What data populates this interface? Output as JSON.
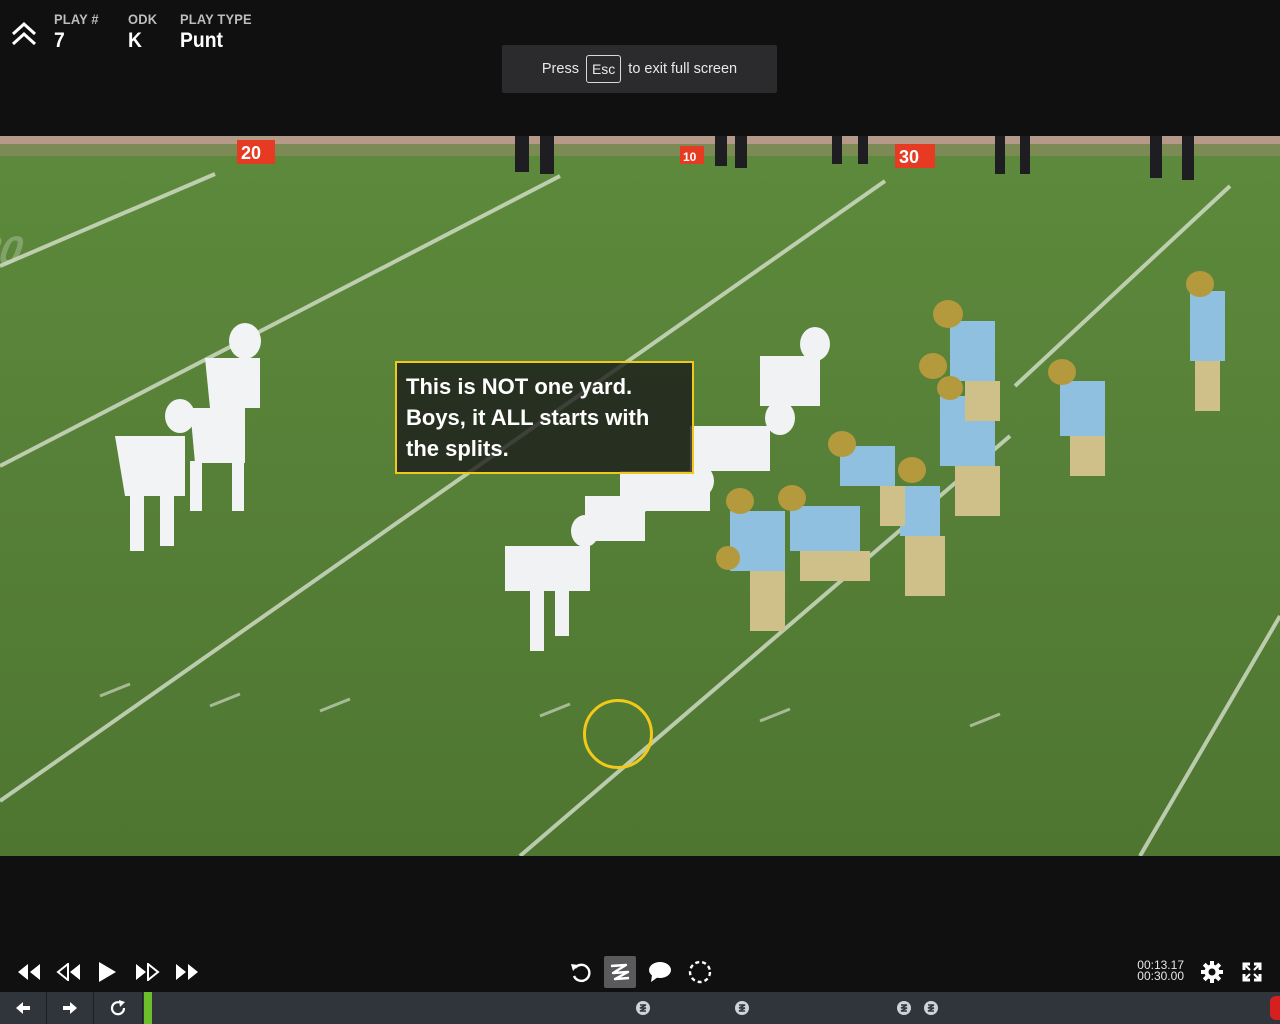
{
  "header": {
    "play_number_label": "PLAY #",
    "play_number_value": "7",
    "odk_label": "ODK",
    "odk_value": "K",
    "play_type_label": "PLAY TYPE",
    "play_type_value": "Punt",
    "collapse_icon": "double-chevron-up-icon"
  },
  "fullscreen_notice": {
    "prefix": "Press",
    "key": "Esc",
    "suffix": "to exit full screen"
  },
  "video": {
    "yard_markers": [
      "20",
      "10",
      "30"
    ],
    "annotation_text": "This is NOT one yard. Boys, it ALL starts with the splits.",
    "annotation_color": "#f2c81a",
    "focus_circle_color": "#f2c81a"
  },
  "controls": {
    "icons": [
      "rewind-icon",
      "step-back-icon",
      "play-icon",
      "step-forward-icon",
      "fast-forward-icon",
      "undo-icon",
      "draw-tool-icon",
      "comment-icon",
      "circle-tool-icon",
      "settings-icon",
      "fullscreen-icon"
    ],
    "current_time": "00:13.17",
    "total_time": "00:30.00"
  },
  "timeline": {
    "icons": [
      "previous-play-icon",
      "next-play-icon",
      "loop-icon"
    ],
    "playhead_color": "#6cbf2a",
    "marker_icon": "drawing-marker-icon",
    "marker_count": 5
  }
}
